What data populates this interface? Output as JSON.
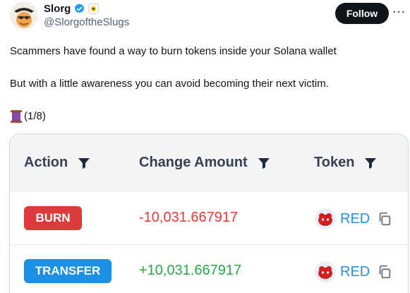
{
  "author": {
    "display_name": "Slorg",
    "handle": "@SlorgoftheSlugs",
    "avatar_icon": "avatar-character",
    "verified_icon": "verified-badge-icon",
    "affiliate_icon": "affiliate-badge-icon"
  },
  "actions": {
    "follow_label": "Follow",
    "more_label": "···"
  },
  "tweet": {
    "line1": "Scammers have found a way to burn tokens inside your Solana wallet",
    "line2": "But with a little awareness you can avoid becoming their next victim.",
    "thread_icon": "spool-of-thread-emoji",
    "thread_counter": "(1/8)"
  },
  "table": {
    "headers": [
      "Action",
      "Change Amount",
      "Token"
    ],
    "filter_icon": "filter-funnel-icon",
    "rows": [
      {
        "action": "BURN",
        "action_color": "#dc3b3b",
        "amount": "-10,031.667917",
        "amount_color": "#e23a3a",
        "token": "RED",
        "token_icon": "red-token-logo",
        "copy_icon": "copy-icon"
      },
      {
        "action": "TRANSFER",
        "action_color": "#1a8fe3",
        "amount": "+10,031.667917",
        "amount_color": "#28a745",
        "token": "RED",
        "token_icon": "red-token-logo",
        "copy_icon": "copy-icon"
      }
    ]
  },
  "colors": {
    "text_primary": "#0f1419",
    "text_secondary": "#536471",
    "verified_blue": "#1d9bf0",
    "token_link": "#2b8fe0"
  }
}
